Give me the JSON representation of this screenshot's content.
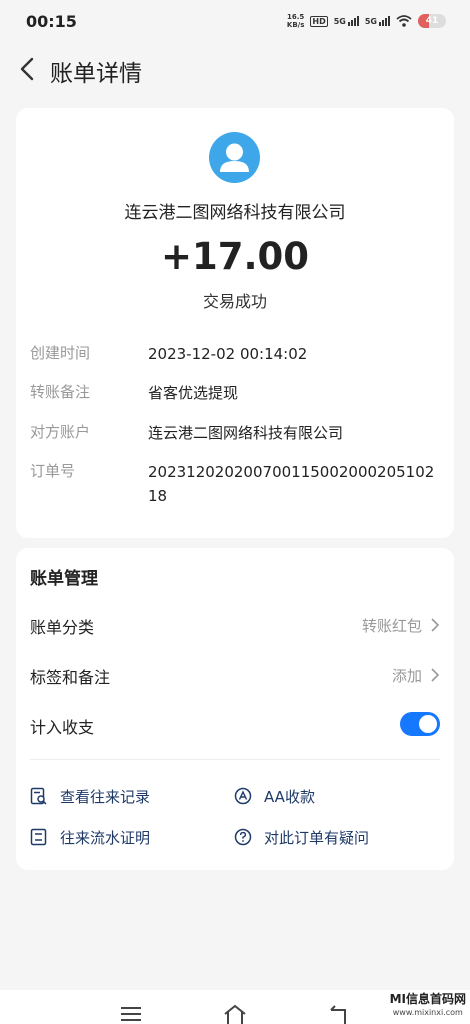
{
  "status_bar": {
    "time": "00:15",
    "net_speed_value": "16.5",
    "net_speed_unit": "KB/s",
    "hd_badge": "HD",
    "signal_1_label": "5G",
    "signal_2_label": "5G",
    "battery_percent": "41"
  },
  "header": {
    "title": "账单详情"
  },
  "summary": {
    "merchant": "连云港二图网络科技有限公司",
    "amount": "+17.00",
    "status": "交易成功",
    "details": [
      {
        "label": "创建时间",
        "value": "2023-12-02 00:14:02"
      },
      {
        "label": "转账备注",
        "value": "省客优选提现"
      },
      {
        "label": "对方账户",
        "value": "连云港二图网络科技有限公司"
      },
      {
        "label": "订单号",
        "value": "20231202020070011500200020510218"
      }
    ]
  },
  "manage": {
    "title": "账单管理",
    "category_label": "账单分类",
    "category_value": "转账红包",
    "tags_label": "标签和备注",
    "tags_value": "添加",
    "count_label": "计入收支",
    "count_enabled": true,
    "actions": {
      "history": "查看往来记录",
      "aa": "AA收款",
      "statement": "往来流水证明",
      "question": "对此订单有疑问"
    }
  },
  "watermark": {
    "title": "MI信息首码网",
    "url": "www.mixinxi.com"
  },
  "colors": {
    "accent": "#1677ff",
    "avatar": "#3ea7ea",
    "action_text": "#1f3a68"
  }
}
